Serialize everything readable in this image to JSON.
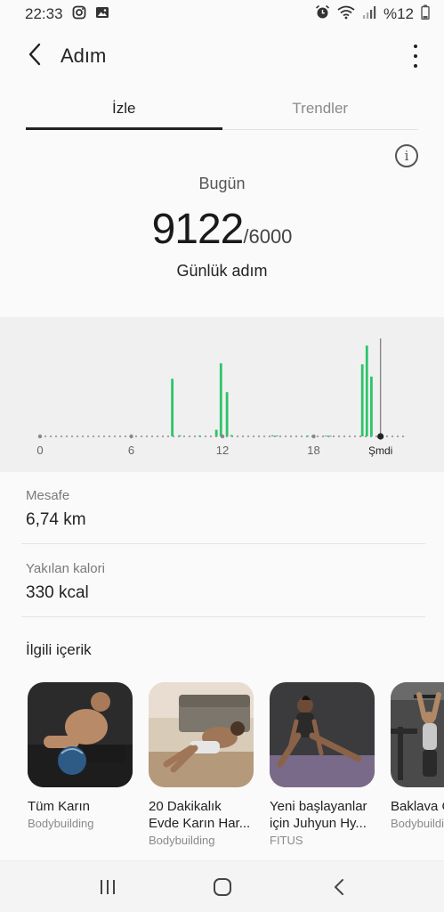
{
  "status_bar": {
    "time": "22:33",
    "battery": "%12",
    "icons": [
      "instagram-icon",
      "gallery-icon",
      "alarm-icon",
      "wifi-icon",
      "signal-icon",
      "battery-icon"
    ]
  },
  "header": {
    "title": "Adım",
    "back_icon": "chevron-left-icon",
    "more_icon": "more-vertical-icon"
  },
  "tabs": [
    {
      "label": "İzle",
      "active": true
    },
    {
      "label": "Trendler",
      "active": false
    }
  ],
  "summary": {
    "day_label": "Bugün",
    "steps": "9122",
    "goal": "/6000",
    "unit_label": "Günlük adım",
    "info_icon": "info-icon"
  },
  "chart_data": {
    "type": "bar",
    "x_ticks": [
      "0",
      "6",
      "12",
      "18",
      "Şmdi"
    ],
    "xlim": [
      0,
      24
    ],
    "bar_color": "#2ec46a",
    "series": [
      {
        "values": [
          {
            "hour": 8.7,
            "v": 520
          },
          {
            "hour": 9.2,
            "v": 10
          },
          {
            "hour": 10.5,
            "v": 8
          },
          {
            "hour": 11.6,
            "v": 60
          },
          {
            "hour": 11.9,
            "v": 660
          },
          {
            "hour": 12.3,
            "v": 400
          },
          {
            "hour": 12.6,
            "v": 12
          },
          {
            "hour": 15.3,
            "v": 10
          },
          {
            "hour": 15.6,
            "v": 8
          },
          {
            "hour": 17.6,
            "v": 6
          },
          {
            "hour": 18.8,
            "v": 8
          },
          {
            "hour": 19.1,
            "v": 6
          },
          {
            "hour": 21.2,
            "v": 650
          },
          {
            "hour": 21.5,
            "v": 820
          },
          {
            "hour": 21.8,
            "v": 540
          }
        ]
      }
    ],
    "now_hour": 22.4
  },
  "stats": [
    {
      "label": "Mesafe",
      "value": "6,74 km"
    },
    {
      "label": "Yakılan kalori",
      "value": "330 kcal"
    }
  ],
  "related": {
    "title": "İlgili içerik",
    "cards": [
      {
        "title": "Tüm Karın",
        "source": "Bodybuilding"
      },
      {
        "title": "20 Dakikalık Evde Karın Har...",
        "source": "Bodybuilding"
      },
      {
        "title": "Yeni başlayanlar için Juhyun Hy...",
        "source": "FITUS"
      },
      {
        "title": "Baklava C...",
        "source": "Bodybuilding"
      }
    ]
  },
  "navbar": {
    "icons": [
      "recent-apps-icon",
      "home-icon",
      "back-icon"
    ]
  }
}
